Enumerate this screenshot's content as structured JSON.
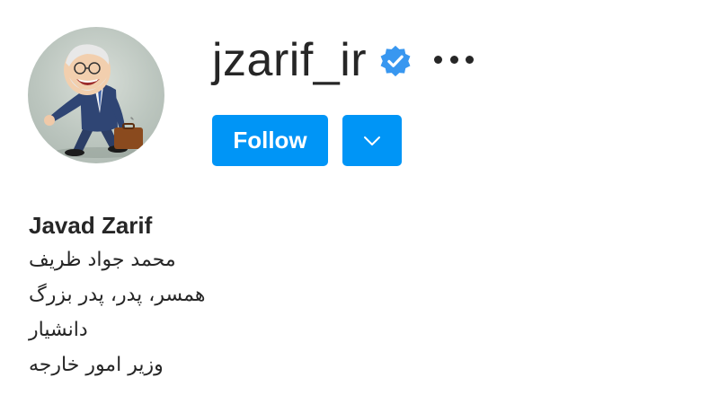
{
  "profile": {
    "username": "jzarif_ir",
    "verified": true,
    "full_name": "Javad Zarif",
    "bio_lines": [
      "محمد جواد ظریف",
      "همسر، پدر، پدر بزرگ",
      "دانشیار",
      "وزیر امور خارجه"
    ]
  },
  "actions": {
    "follow_label": "Follow",
    "dropdown_icon": "chevron-down-icon",
    "more_icon": "more-options-icon"
  },
  "colors": {
    "accent": "#0095f6",
    "verified_badge": "#3897f0",
    "text": "#262626"
  }
}
